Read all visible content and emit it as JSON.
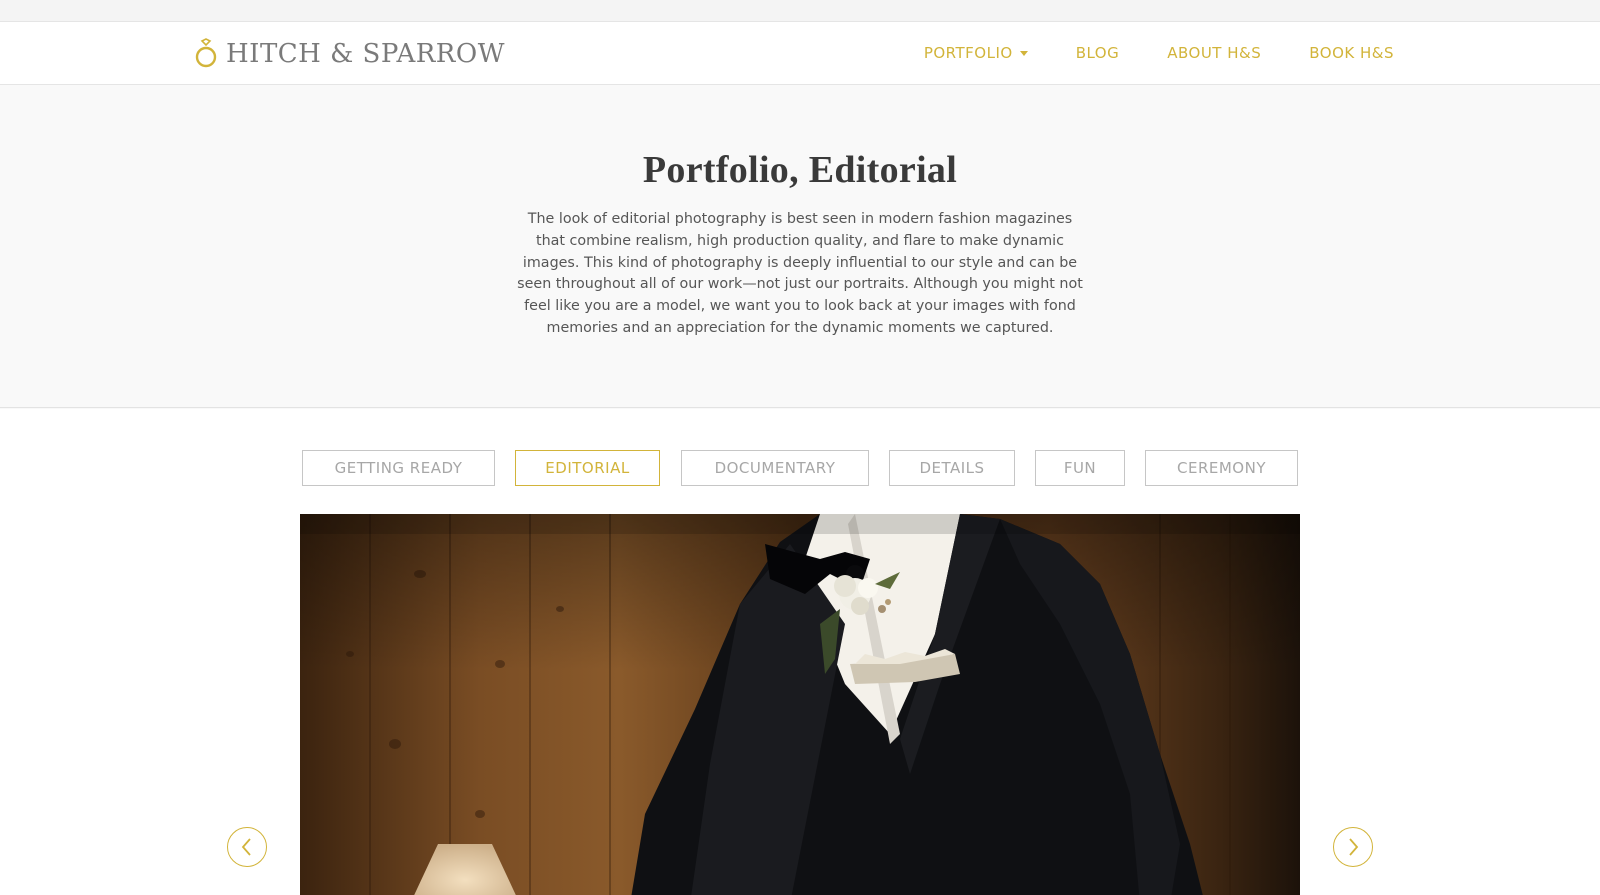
{
  "brand": {
    "name": "HITCH & SPARROW",
    "icon": "ring-icon"
  },
  "nav": {
    "items": [
      {
        "label": "PORTFOLIO",
        "has_dropdown": true
      },
      {
        "label": "BLOG"
      },
      {
        "label": "ABOUT H&S"
      },
      {
        "label": "BOOK H&S"
      }
    ]
  },
  "intro": {
    "title": "Portfolio, Editorial",
    "lines": [
      "The look of editorial photography is best seen in modern fashion magazines",
      "that combine realism, high production quality, and flare to make dynamic",
      "images. This kind of photography is deeply influential to our style and can be",
      "seen throughout all of our work—not just our portraits. Although you might not",
      "feel like you are a model, we want you to look back at your images with fond",
      "memories and an appreciation for the dynamic moments we captured."
    ]
  },
  "filters": {
    "items": [
      "GETTING READY",
      "EDITORIAL",
      "DOCUMENTARY",
      "DETAILS",
      "FUN",
      "CEREMONY"
    ],
    "active": "EDITORIAL"
  },
  "gallery": {
    "prev_icon": "chevron-left-icon",
    "next_icon": "chevron-right-icon"
  },
  "colors": {
    "accent": "#d2b43a",
    "brand_text": "#7a7a7a",
    "body_text": "#565656",
    "title_text": "#3a3a3a",
    "filter_border": "#c6c6c6",
    "filter_text": "#a7a7a7"
  }
}
